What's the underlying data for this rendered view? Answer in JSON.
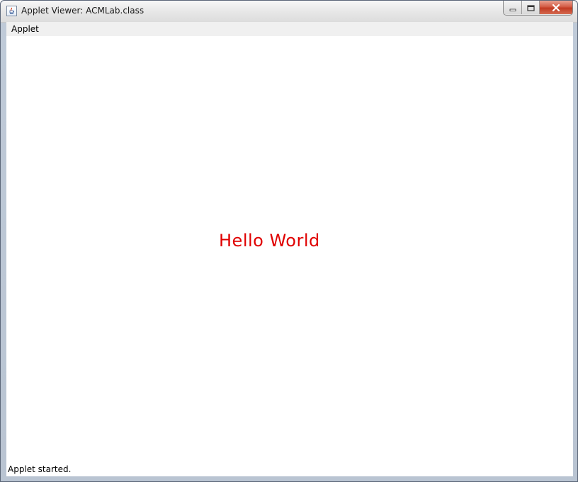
{
  "window": {
    "title": "Applet Viewer: ACMLab.class"
  },
  "menubar": {
    "items": [
      {
        "label": "Applet"
      }
    ]
  },
  "canvas": {
    "text": "Hello World",
    "text_color": "#e00000"
  },
  "status": {
    "text": "Applet started."
  },
  "icons": {
    "app": "java-cup-icon",
    "minimize": "minimize-icon",
    "maximize": "maximize-icon",
    "close": "close-icon"
  }
}
